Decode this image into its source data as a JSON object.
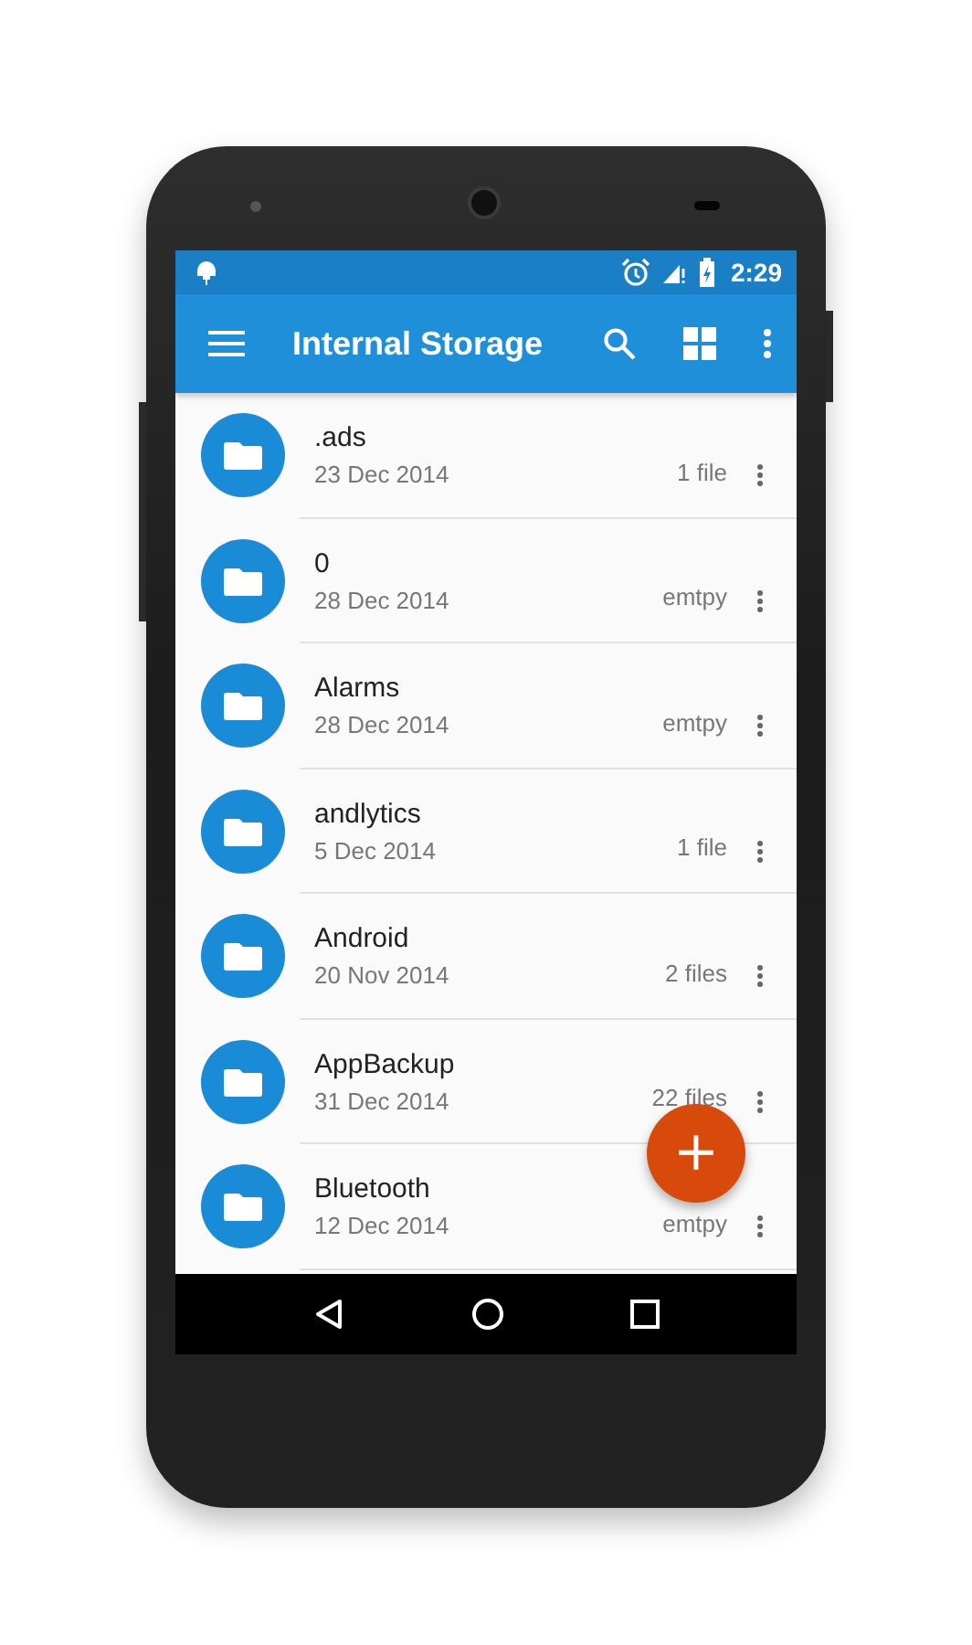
{
  "status_bar": {
    "time": "2:29"
  },
  "toolbar": {
    "title": "Internal Storage"
  },
  "files": [
    {
      "name": ".ads",
      "date": "23 Dec 2014",
      "size": "1 file"
    },
    {
      "name": "0",
      "date": "28 Dec 2014",
      "size": "emtpy"
    },
    {
      "name": "Alarms",
      "date": "28 Dec 2014",
      "size": "emtpy"
    },
    {
      "name": "andlytics",
      "date": "5 Dec 2014",
      "size": "1 file"
    },
    {
      "name": "Android",
      "date": "20 Nov 2014",
      "size": "2 files"
    },
    {
      "name": "AppBackup",
      "date": "31 Dec 2014",
      "size": "22 files"
    },
    {
      "name": "Bluetooth",
      "date": "12 Dec 2014",
      "size": "emtpy"
    }
  ],
  "fab": {
    "label": "+"
  }
}
